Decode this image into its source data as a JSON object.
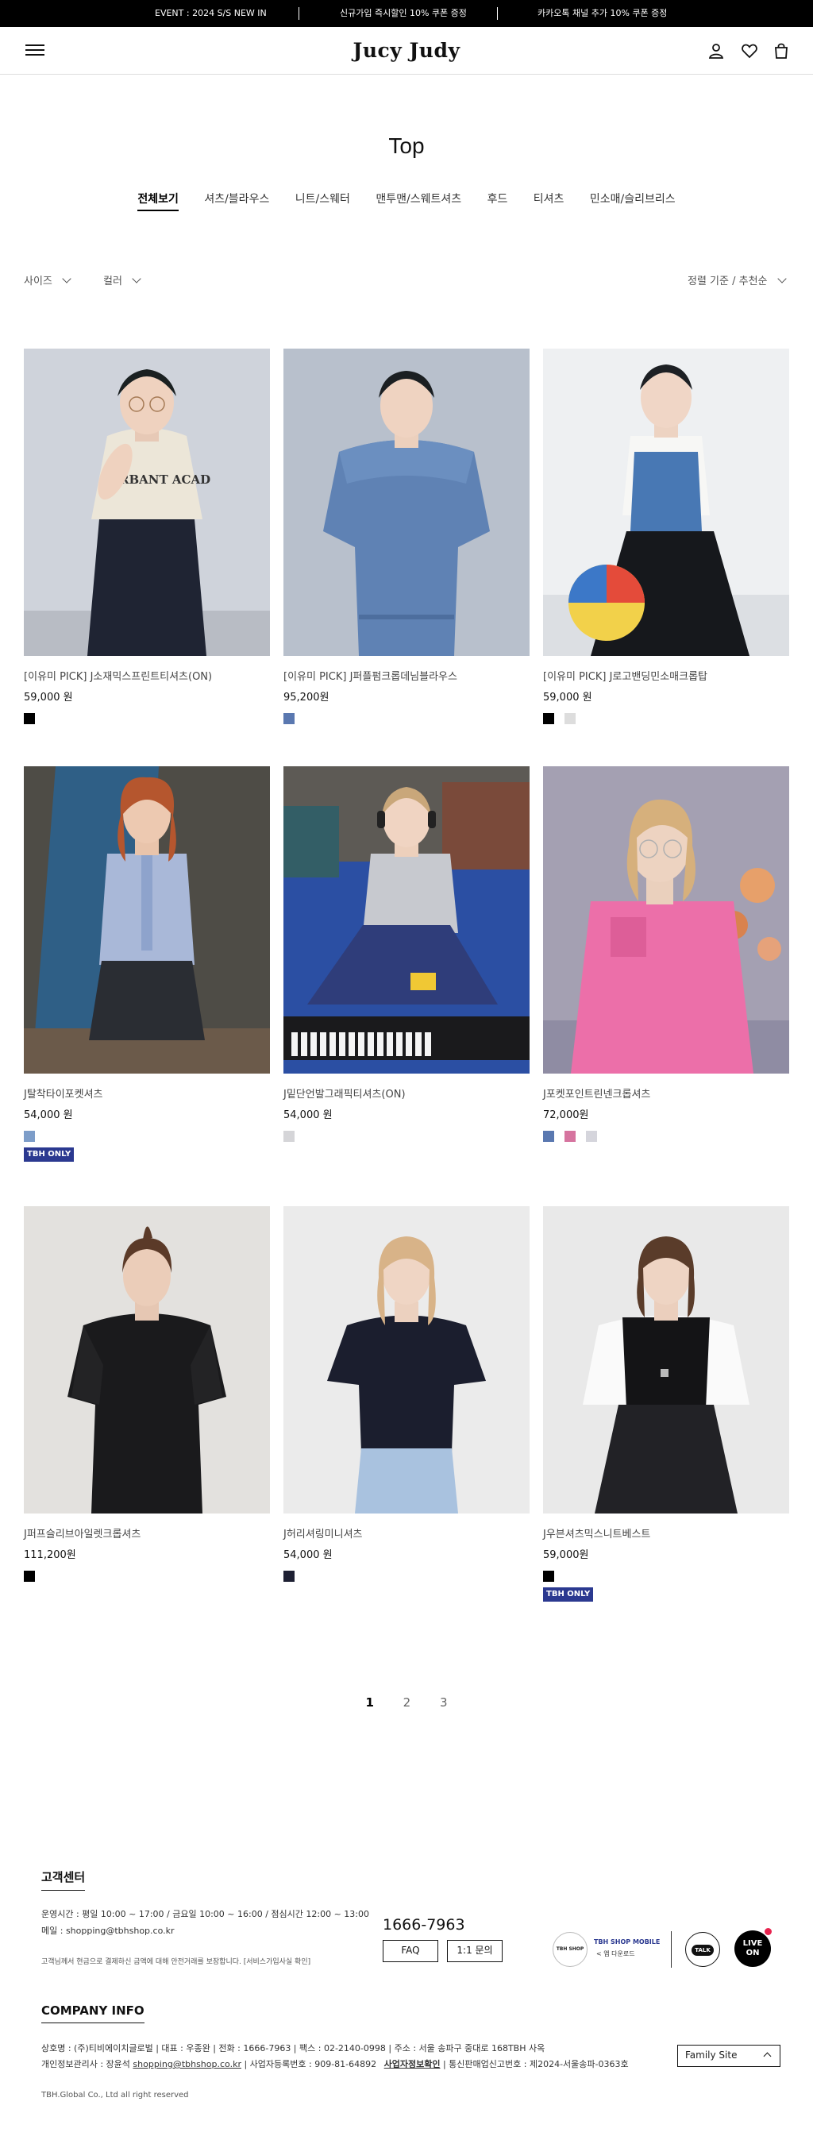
{
  "event_bar": {
    "items": [
      "EVENT : 2024 S/S  NEW IN",
      "신규가입 즉시할인 10% 쿠폰 증정",
      "카카오톡 채널 추가 10% 쿠폰 증정"
    ]
  },
  "header": {
    "logo": "Jucy Judy",
    "icons": [
      "menu-icon",
      "user-icon",
      "heart-icon",
      "bag-icon"
    ]
  },
  "page": {
    "title": "Top",
    "categories": [
      "전체보기",
      "셔츠/블라우스",
      "니트/스웨터",
      "맨투맨/스웨트셔츠",
      "후드",
      "티셔츠",
      "민소매/슬리브리스"
    ],
    "active_category": "전체보기"
  },
  "filters": {
    "size": "사이즈",
    "color": "컬러",
    "sort": "정렬 기준 / 추천순"
  },
  "products": [
    {
      "name": "[이유미 PICK] J소재믹스프린트티셔츠(ON)",
      "price": "59,000 원",
      "swatches": [
        "#000000"
      ],
      "badge": ""
    },
    {
      "name": "[이유미 PICK] J퍼플펌크롭데님블라우스",
      "price": "95,200원",
      "swatches": [
        "#5a78b0"
      ],
      "badge": ""
    },
    {
      "name": "[이유미 PICK] J로고밴딩민소매크롭탑",
      "price": "59,000 원",
      "swatches": [
        "#000000",
        "#dddddd"
      ],
      "badge": ""
    },
    {
      "name": "J탈착타이포켓셔츠",
      "price": "54,000 원",
      "swatches": [
        "#7d9dc9"
      ],
      "badge": "TBH ONLY"
    },
    {
      "name": "J밑단언발그래픽티셔츠(ON)",
      "price": "54,000 원",
      "swatches": [
        "#d5d5d8"
      ],
      "badge": ""
    },
    {
      "name": "J포켓포인트린넨크롭셔츠",
      "price": "72,000원",
      "swatches": [
        "#5a78b0",
        "#d6749f",
        "#d5d5dc"
      ],
      "badge": ""
    },
    {
      "name": "J퍼프슬리브아일렛크롭셔츠",
      "price": "111,200원",
      "swatches": [
        "#000000"
      ],
      "badge": ""
    },
    {
      "name": "J허리셔링미니셔츠",
      "price": "54,000 원",
      "swatches": [
        "#1e2033"
      ],
      "badge": ""
    },
    {
      "name": "J우븐셔츠믹스니트베스트",
      "price": "59,000원",
      "swatches": [
        "#000000"
      ],
      "badge": "TBH ONLY"
    }
  ],
  "pagination": [
    "1",
    "2",
    "3"
  ],
  "pagination_active": "1",
  "footer": {
    "cs_title": "고객센터",
    "hours": "운영시간 : 평일 10:00 ~ 17:00 / 금요일 10:00 ~ 16:00 / 점심시간 12:00 ~ 13:00",
    "email": "메일 : shopping@tbhshop.co.kr",
    "notice": "고객님께서 현금으로 결제하신 금액에 대해 안전거래를 보장합니다. [서비스가입사실 확인]",
    "phone": "1666-7963",
    "faq": "FAQ",
    "inquiry": "1:1 문의",
    "app_badge_small": "TBH SHOP",
    "app_title": "TBH SHOP MOBILE",
    "app_sub": "앱 다운로드",
    "talk": "TALK",
    "live": "LIVE ON",
    "company_title": "COMPANY INFO",
    "company_line1": "상호명 : (주)티비에이치글로벌   |   대표 : 우종완   |   전화 : 1666-7963   |   팩스 : 02-2140-0998   |   주소 : 서울 송파구 중대로 168TBH 사옥",
    "company_line2_a": "개인정보관리사 : 장윤석",
    "company_line2_email": "shopping@tbhshop.co.kr",
    "company_line2_b": "  |   사업자등록번호 : 909-81-64892",
    "company_line2_link": "사업자정보확인",
    "company_line2_c": "  |   통신판매업신고번호 : 제2024-서울송파-0363호",
    "copyright": "TBH.Global Co., Ltd all right reserved",
    "family_site": "Family Site"
  }
}
